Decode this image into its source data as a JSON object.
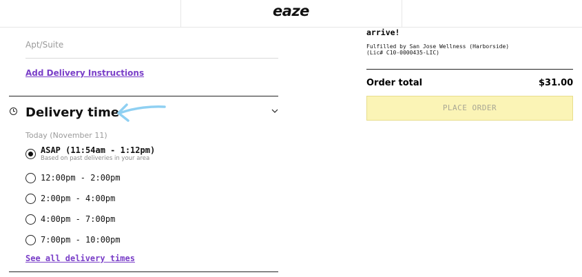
{
  "header": {
    "logo": "eaze"
  },
  "address": {
    "apt_placeholder": "Apt/Suite",
    "add_instructions": "Add Delivery Instructions"
  },
  "delivery_time": {
    "title": "Delivery time",
    "day": "Today (November 11)",
    "options": [
      {
        "label": "ASAP (11:54am - 1:12pm)",
        "sublabel": "Based on past deliveries in your area",
        "selected": true
      },
      {
        "label": "12:00pm - 2:00pm",
        "selected": false
      },
      {
        "label": "2:00pm - 4:00pm",
        "selected": false
      },
      {
        "label": "4:00pm - 7:00pm",
        "selected": false
      },
      {
        "label": "7:00pm - 10:00pm",
        "selected": false
      }
    ],
    "see_all": "See all delivery times"
  },
  "summary": {
    "arrive_text": "arrive!",
    "fulfilled_line1": "Fulfilled by San Jose Wellness (Harborside)",
    "fulfilled_line2": "(Lic# C10-0000435-LIC)",
    "order_total_label": "Order total",
    "order_total_value": "$31.00",
    "place_order": "PLACE ORDER"
  },
  "colors": {
    "link": "#7a3fc8",
    "place_order_bg": "#fbf4b6",
    "annotation_arrow": "#8fd0f2"
  }
}
